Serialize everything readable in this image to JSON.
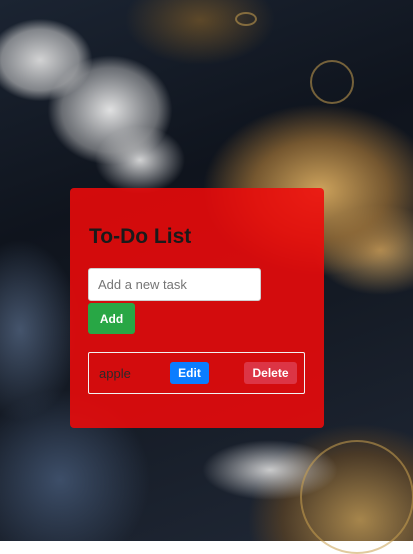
{
  "app": {
    "title": "To-Do List"
  },
  "new_task": {
    "placeholder": "Add a new task",
    "value": "",
    "add_label": "Add"
  },
  "tasks": [
    {
      "text": "apple",
      "edit_label": "Edit",
      "delete_label": "Delete"
    }
  ],
  "colors": {
    "card": "#ee0a0a",
    "add_button": "#28a745",
    "edit_button": "#0b7dff",
    "delete_button": "#dc3545"
  }
}
